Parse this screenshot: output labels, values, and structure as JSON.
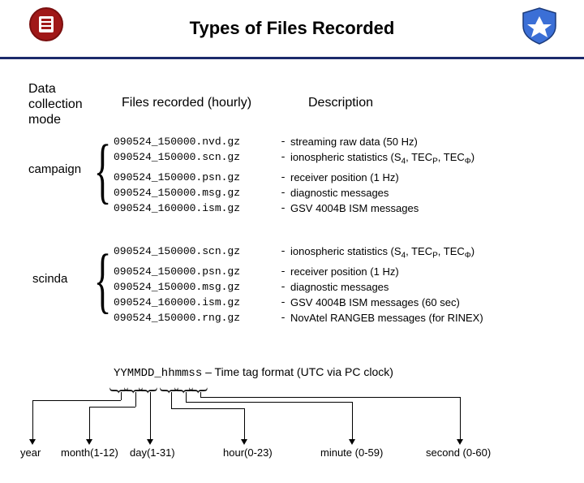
{
  "title": "Types of Files Recorded",
  "columns": {
    "c1": "Data collection mode",
    "c2": "Files recorded (hourly)",
    "c3": "Description"
  },
  "mode1": "campaign",
  "mode2": "scinda",
  "group1": [
    {
      "f": "090524_150000.nvd.gz",
      "d": "streaming raw data (50 Hz)"
    },
    {
      "f": "090524_150000.scn.gz",
      "d": "ionospheric statistics (S4, TECP, TECΦ)"
    },
    {
      "f": "090524_150000.psn.gz",
      "d": "receiver position  (1 Hz)"
    },
    {
      "f": "090524_150000.msg.gz",
      "d": "diagnostic messages"
    },
    {
      "f": "090524_160000.ism.gz",
      "d": "GSV 4004B ISM messages"
    }
  ],
  "group2": [
    {
      "f": "090524_150000.scn.gz",
      "d": "ionospheric statistics (S4, TECP, TECΦ)"
    },
    {
      "f": "090524_150000.psn.gz",
      "d": "receiver position  (1 Hz)"
    },
    {
      "f": "090524_150000.msg.gz",
      "d": "diagnostic messages"
    },
    {
      "f": "090524_160000.ism.gz",
      "d": "GSV 4004B ISM messages (60 sec)"
    },
    {
      "f": "090524_150000.rng.gz",
      "d": "NovAtel RANGEB messages (for RINEX)"
    }
  ],
  "timefmt": {
    "pattern": "YYMMDD_hhmmss",
    "desc": " – Time tag format (UTC via PC clock)"
  },
  "arrows": {
    "year": "year",
    "month": "month(1-12)",
    "day": "day(1-31)",
    "hour": "hour(0-23)",
    "minute": "minute (0-59)",
    "second": "second (0-60)"
  }
}
